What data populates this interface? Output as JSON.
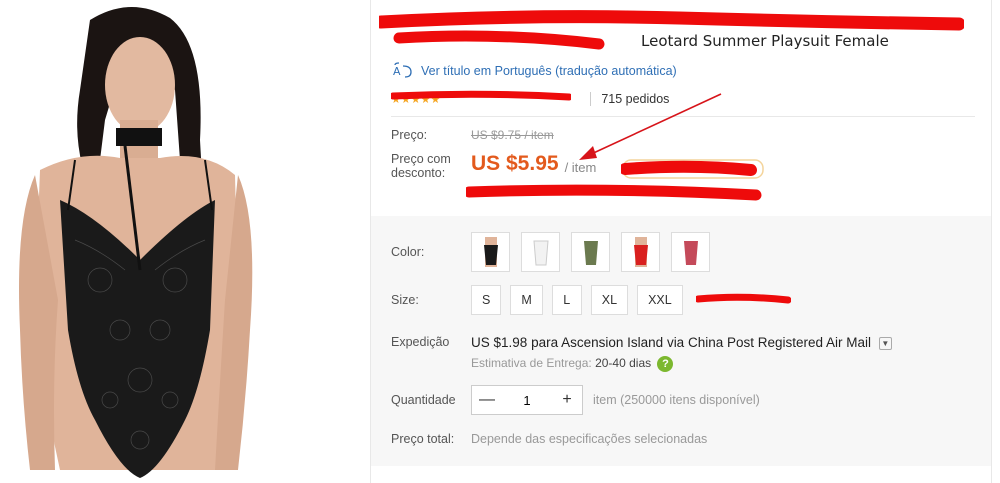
{
  "product": {
    "title_visible": "Leotard Summer Playsuit Female",
    "translate_link": "Ver título em Português (tradução automática)",
    "orders": "715 pedidos"
  },
  "icons": {
    "translate": "translate-icon",
    "star": "star-icon",
    "dropdown": "chevron-down-icon",
    "help": "question-mark-icon",
    "minus": "minus-icon",
    "plus": "plus-icon"
  },
  "price": {
    "label": "Preço:",
    "original": "US $9.75 / item",
    "discount_label_1": "Preço com",
    "discount_label_2": "desconto:",
    "discount_value": "US $5.95",
    "per_item": "/ item"
  },
  "options": {
    "color_label": "Color:",
    "colors": [
      "black",
      "white",
      "army-green",
      "red",
      "wine-red"
    ],
    "size_label": "Size:",
    "sizes": [
      "S",
      "M",
      "L",
      "XL",
      "XXL"
    ]
  },
  "shipping": {
    "label": "Expedição",
    "price": "US $1.98",
    "text_para": "para",
    "destination": "Ascension Island",
    "text_via": "via",
    "carrier": "China Post Registered Air Mail",
    "estimate_label": "Estimativa de Entrega:",
    "estimate_days": "20-40 dias",
    "help_glyph": "?"
  },
  "quantity": {
    "label": "Quantidade",
    "value": "1",
    "minus": "—",
    "plus": "+",
    "available": "item (250000 itens disponível)"
  },
  "total": {
    "label": "Preço total:",
    "value": "Depende das especificações selecionadas"
  },
  "colors": {
    "accent_price": "#e35a1d",
    "link": "#2f6fb5",
    "scribble": "#ee0b0b",
    "star": "#f5a623",
    "help_green": "#7cb82f"
  }
}
